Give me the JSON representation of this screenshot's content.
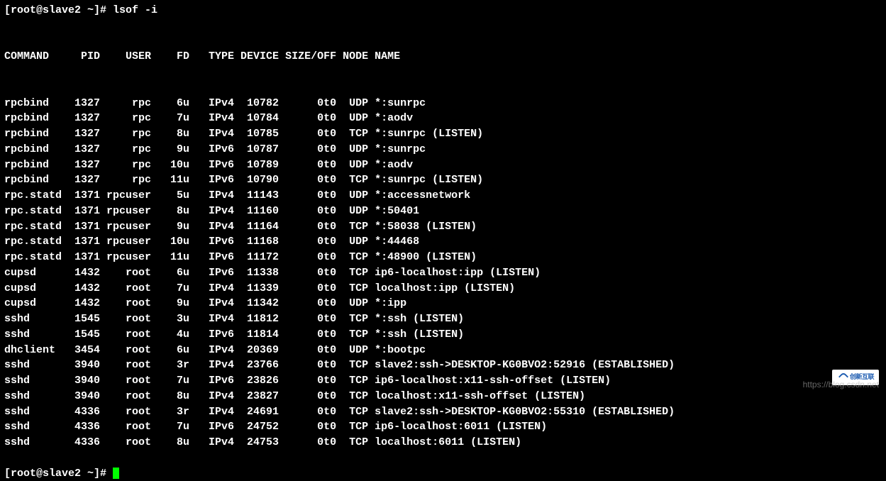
{
  "prompt": "[root@slave2 ~]# ",
  "command": "lsof -i",
  "prompt2": "[root@slave2 ~]# ",
  "headers": {
    "command": "COMMAND",
    "pid": "PID",
    "user": "USER",
    "fd": "FD",
    "type": "TYPE",
    "device": "DEVICE",
    "sizeoff": "SIZE/OFF",
    "node": "NODE",
    "name": "NAME"
  },
  "rows": [
    {
      "command": "rpcbind",
      "pid": "1327",
      "user": "rpc",
      "fd": "6u",
      "type": "IPv4",
      "device": "10782",
      "sizeoff": "0t0",
      "node": "UDP",
      "name": "*:sunrpc"
    },
    {
      "command": "rpcbind",
      "pid": "1327",
      "user": "rpc",
      "fd": "7u",
      "type": "IPv4",
      "device": "10784",
      "sizeoff": "0t0",
      "node": "UDP",
      "name": "*:aodv"
    },
    {
      "command": "rpcbind",
      "pid": "1327",
      "user": "rpc",
      "fd": "8u",
      "type": "IPv4",
      "device": "10785",
      "sizeoff": "0t0",
      "node": "TCP",
      "name": "*:sunrpc (LISTEN)"
    },
    {
      "command": "rpcbind",
      "pid": "1327",
      "user": "rpc",
      "fd": "9u",
      "type": "IPv6",
      "device": "10787",
      "sizeoff": "0t0",
      "node": "UDP",
      "name": "*:sunrpc"
    },
    {
      "command": "rpcbind",
      "pid": "1327",
      "user": "rpc",
      "fd": "10u",
      "type": "IPv6",
      "device": "10789",
      "sizeoff": "0t0",
      "node": "UDP",
      "name": "*:aodv"
    },
    {
      "command": "rpcbind",
      "pid": "1327",
      "user": "rpc",
      "fd": "11u",
      "type": "IPv6",
      "device": "10790",
      "sizeoff": "0t0",
      "node": "TCP",
      "name": "*:sunrpc (LISTEN)"
    },
    {
      "command": "rpc.statd",
      "pid": "1371",
      "user": "rpcuser",
      "fd": "5u",
      "type": "IPv4",
      "device": "11143",
      "sizeoff": "0t0",
      "node": "UDP",
      "name": "*:accessnetwork"
    },
    {
      "command": "rpc.statd",
      "pid": "1371",
      "user": "rpcuser",
      "fd": "8u",
      "type": "IPv4",
      "device": "11160",
      "sizeoff": "0t0",
      "node": "UDP",
      "name": "*:50401"
    },
    {
      "command": "rpc.statd",
      "pid": "1371",
      "user": "rpcuser",
      "fd": "9u",
      "type": "IPv4",
      "device": "11164",
      "sizeoff": "0t0",
      "node": "TCP",
      "name": "*:58038 (LISTEN)"
    },
    {
      "command": "rpc.statd",
      "pid": "1371",
      "user": "rpcuser",
      "fd": "10u",
      "type": "IPv6",
      "device": "11168",
      "sizeoff": "0t0",
      "node": "UDP",
      "name": "*:44468"
    },
    {
      "command": "rpc.statd",
      "pid": "1371",
      "user": "rpcuser",
      "fd": "11u",
      "type": "IPv6",
      "device": "11172",
      "sizeoff": "0t0",
      "node": "TCP",
      "name": "*:48900 (LISTEN)"
    },
    {
      "command": "cupsd",
      "pid": "1432",
      "user": "root",
      "fd": "6u",
      "type": "IPv6",
      "device": "11338",
      "sizeoff": "0t0",
      "node": "TCP",
      "name": "ip6-localhost:ipp (LISTEN)"
    },
    {
      "command": "cupsd",
      "pid": "1432",
      "user": "root",
      "fd": "7u",
      "type": "IPv4",
      "device": "11339",
      "sizeoff": "0t0",
      "node": "TCP",
      "name": "localhost:ipp (LISTEN)"
    },
    {
      "command": "cupsd",
      "pid": "1432",
      "user": "root",
      "fd": "9u",
      "type": "IPv4",
      "device": "11342",
      "sizeoff": "0t0",
      "node": "UDP",
      "name": "*:ipp"
    },
    {
      "command": "sshd",
      "pid": "1545",
      "user": "root",
      "fd": "3u",
      "type": "IPv4",
      "device": "11812",
      "sizeoff": "0t0",
      "node": "TCP",
      "name": "*:ssh (LISTEN)"
    },
    {
      "command": "sshd",
      "pid": "1545",
      "user": "root",
      "fd": "4u",
      "type": "IPv6",
      "device": "11814",
      "sizeoff": "0t0",
      "node": "TCP",
      "name": "*:ssh (LISTEN)"
    },
    {
      "command": "dhclient",
      "pid": "3454",
      "user": "root",
      "fd": "6u",
      "type": "IPv4",
      "device": "20369",
      "sizeoff": "0t0",
      "node": "UDP",
      "name": "*:bootpc"
    },
    {
      "command": "sshd",
      "pid": "3940",
      "user": "root",
      "fd": "3r",
      "type": "IPv4",
      "device": "23766",
      "sizeoff": "0t0",
      "node": "TCP",
      "name": "slave2:ssh->DESKTOP-KG0BVO2:52916 (ESTABLISHED)"
    },
    {
      "command": "sshd",
      "pid": "3940",
      "user": "root",
      "fd": "7u",
      "type": "IPv6",
      "device": "23826",
      "sizeoff": "0t0",
      "node": "TCP",
      "name": "ip6-localhost:x11-ssh-offset (LISTEN)"
    },
    {
      "command": "sshd",
      "pid": "3940",
      "user": "root",
      "fd": "8u",
      "type": "IPv4",
      "device": "23827",
      "sizeoff": "0t0",
      "node": "TCP",
      "name": "localhost:x11-ssh-offset (LISTEN)"
    },
    {
      "command": "sshd",
      "pid": "4336",
      "user": "root",
      "fd": "3r",
      "type": "IPv4",
      "device": "24691",
      "sizeoff": "0t0",
      "node": "TCP",
      "name": "slave2:ssh->DESKTOP-KG0BVO2:55310 (ESTABLISHED)"
    },
    {
      "command": "sshd",
      "pid": "4336",
      "user": "root",
      "fd": "7u",
      "type": "IPv6",
      "device": "24752",
      "sizeoff": "0t0",
      "node": "TCP",
      "name": "ip6-localhost:6011 (LISTEN)"
    },
    {
      "command": "sshd",
      "pid": "4336",
      "user": "root",
      "fd": "8u",
      "type": "IPv4",
      "device": "24753",
      "sizeoff": "0t0",
      "node": "TCP",
      "name": "localhost:6011 (LISTEN)"
    }
  ],
  "watermark": "https://blog.csdn.net",
  "logo_text": "创新互联"
}
